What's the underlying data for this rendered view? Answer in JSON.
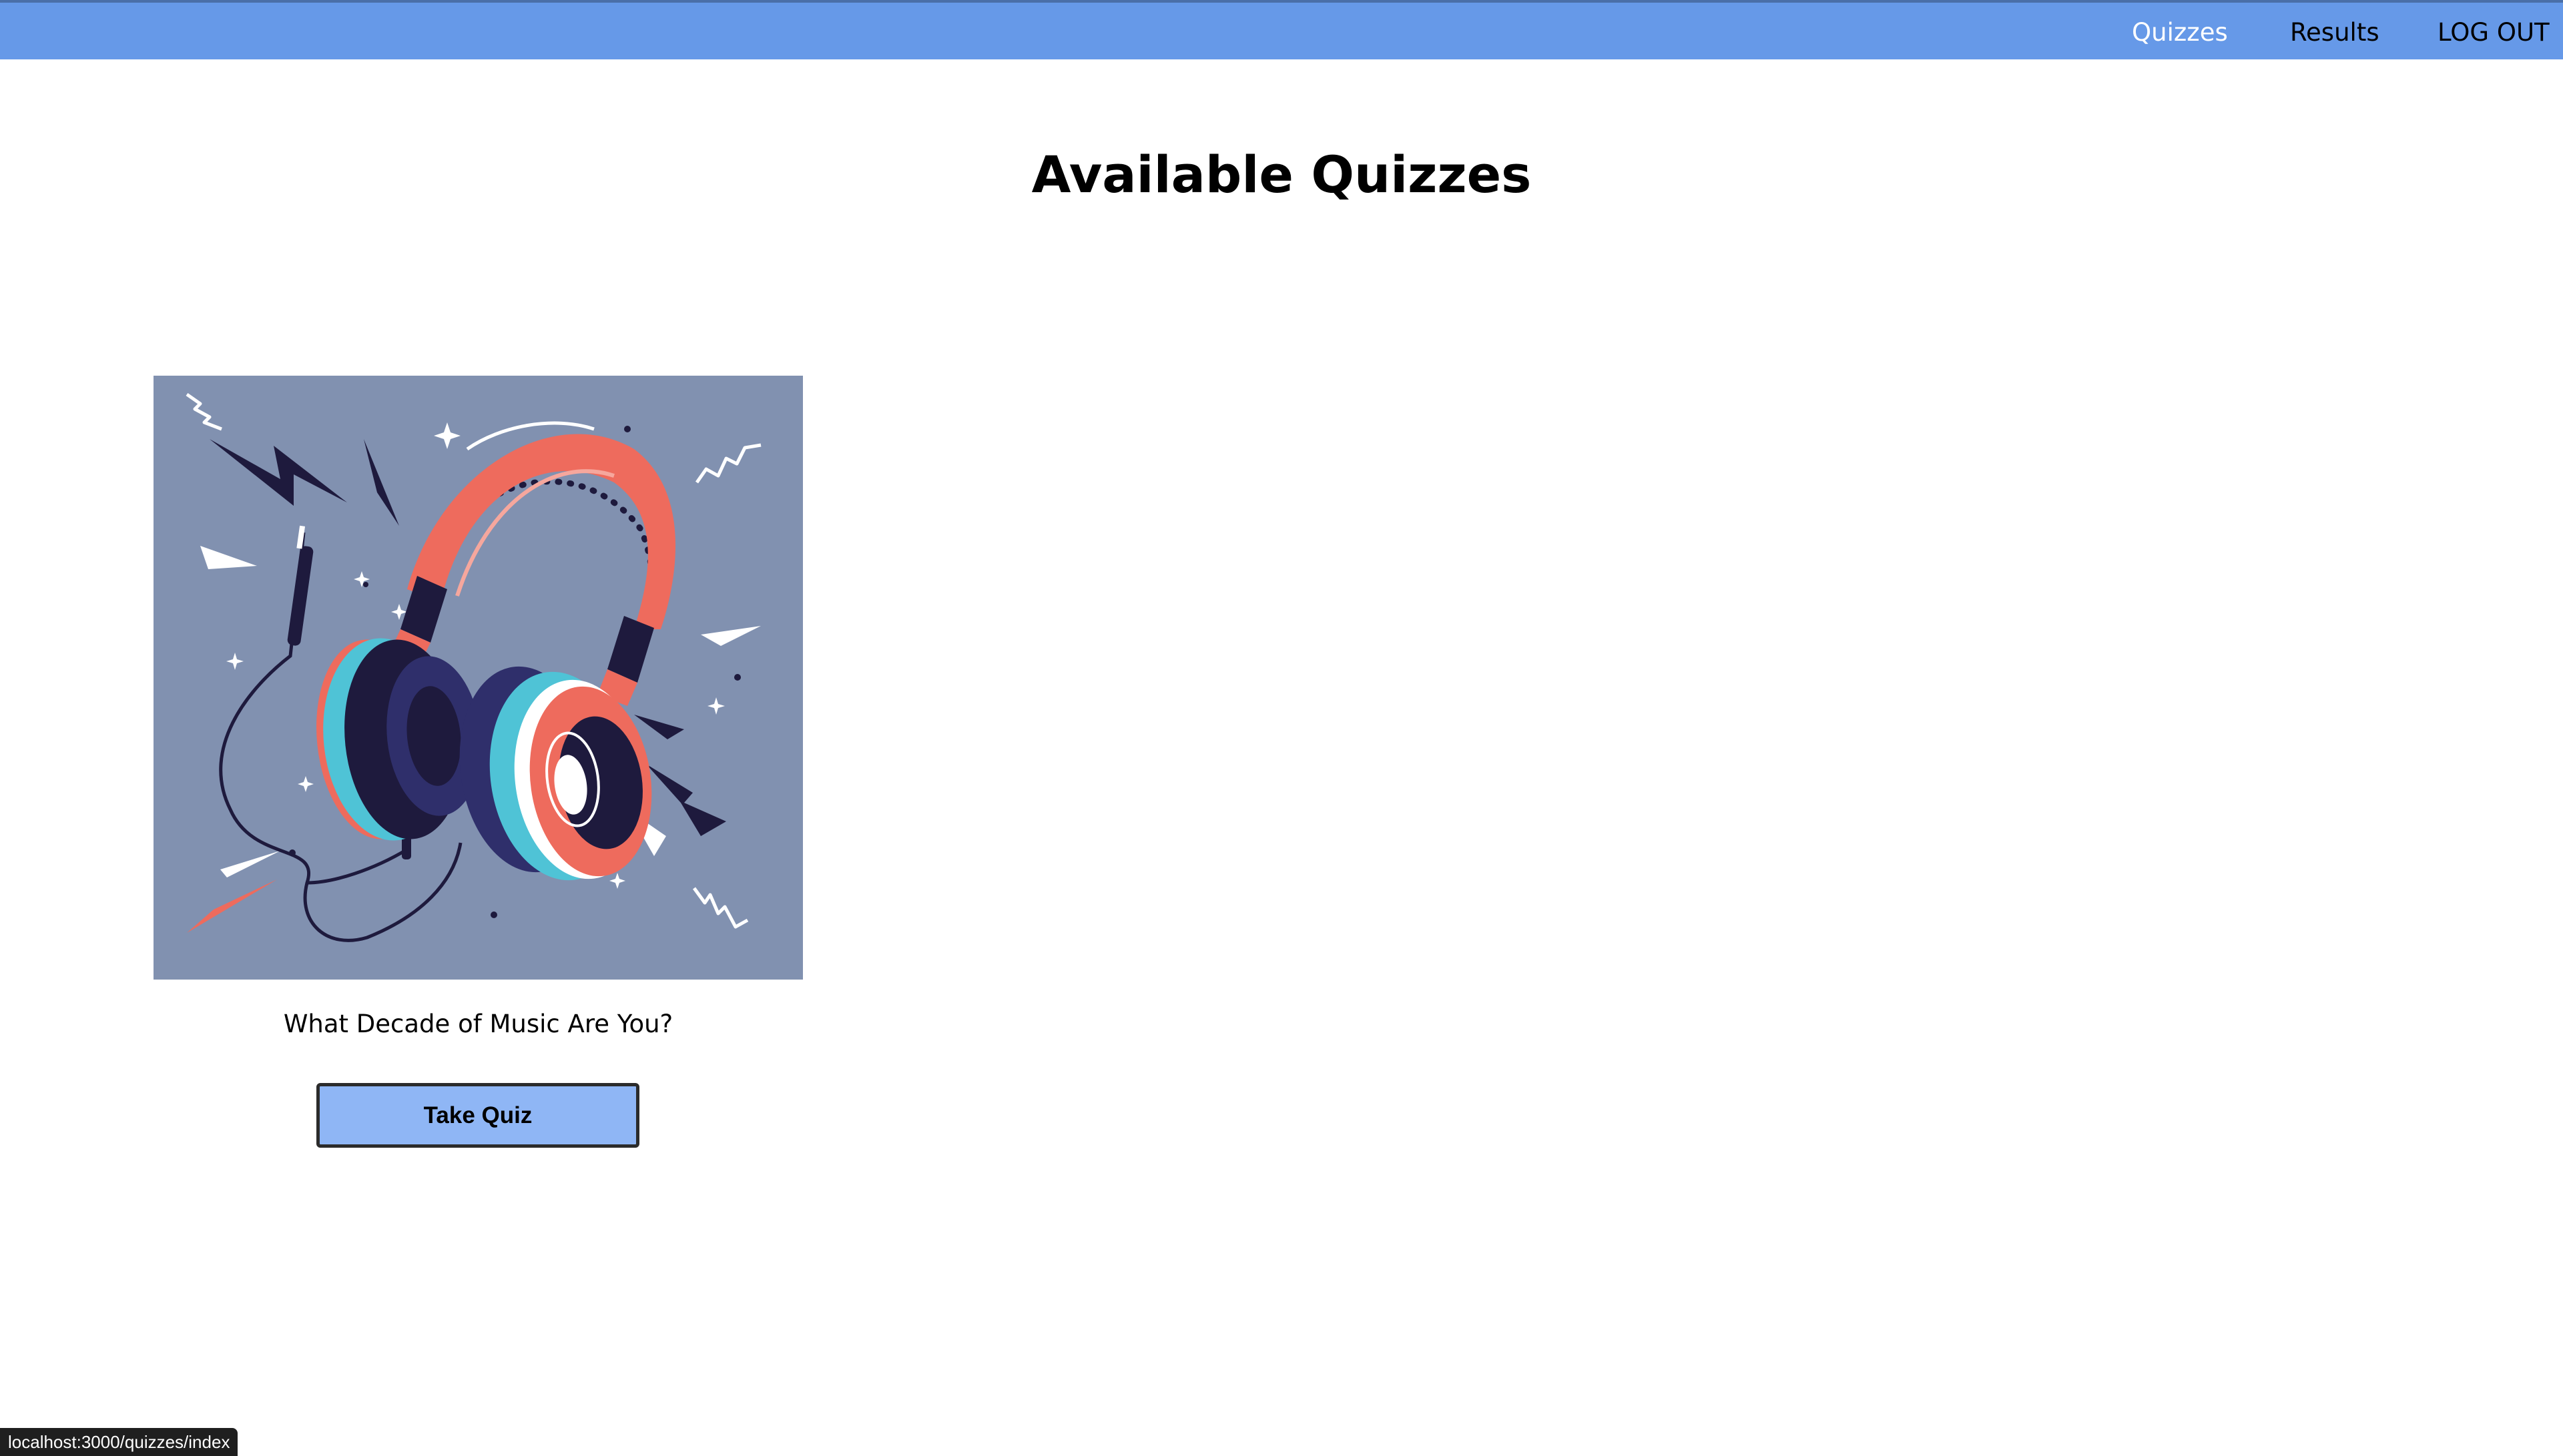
{
  "nav": {
    "items": [
      {
        "label": "Quizzes",
        "active": true
      },
      {
        "label": "Results",
        "active": false
      },
      {
        "label": "LOG OUT",
        "active": false
      }
    ],
    "background_color": "#6699e8"
  },
  "page": {
    "title": "Available Quizzes"
  },
  "quizzes": [
    {
      "image_icon": "headphones-illustration",
      "title": "What Decade of Music Are You?",
      "button_label": "Take Quiz"
    }
  ],
  "status_bar": {
    "url": "localhost:3000/quizzes/index"
  },
  "colors": {
    "accent": "#6699e8",
    "button": "#8fb6f5",
    "illustration_background": "#8191b0",
    "headphone_red": "#ee6b5d",
    "headphone_cyan": "#4fc3d6",
    "headphone_navy": "#1e1a3d"
  }
}
